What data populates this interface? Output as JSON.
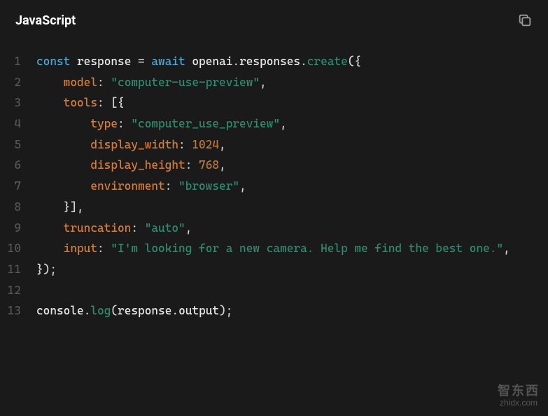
{
  "header": {
    "language_label": "JavaScript"
  },
  "code": {
    "lines": [
      {
        "num": "1",
        "tokens": [
          {
            "cls": "tk-keyword",
            "t": "const"
          },
          {
            "cls": "",
            "t": " "
          },
          {
            "cls": "tk-variable",
            "t": "response"
          },
          {
            "cls": "",
            "t": " "
          },
          {
            "cls": "tk-operator",
            "t": "="
          },
          {
            "cls": "",
            "t": " "
          },
          {
            "cls": "tk-keyword",
            "t": "await"
          },
          {
            "cls": "",
            "t": " "
          },
          {
            "cls": "tk-object",
            "t": "openai"
          },
          {
            "cls": "tk-punct",
            "t": "."
          },
          {
            "cls": "tk-object",
            "t": "responses"
          },
          {
            "cls": "tk-punct",
            "t": "."
          },
          {
            "cls": "tk-method",
            "t": "create"
          },
          {
            "cls": "tk-punct",
            "t": "({"
          }
        ]
      },
      {
        "num": "2",
        "tokens": [
          {
            "cls": "",
            "t": "    "
          },
          {
            "cls": "tk-propkey",
            "t": "model"
          },
          {
            "cls": "tk-punct",
            "t": ": "
          },
          {
            "cls": "tk-string",
            "t": "\"computer-use-preview\""
          },
          {
            "cls": "tk-punct",
            "t": ","
          }
        ]
      },
      {
        "num": "3",
        "tokens": [
          {
            "cls": "",
            "t": "    "
          },
          {
            "cls": "tk-propkey",
            "t": "tools"
          },
          {
            "cls": "tk-punct",
            "t": ": [{"
          }
        ]
      },
      {
        "num": "4",
        "tokens": [
          {
            "cls": "",
            "t": "        "
          },
          {
            "cls": "tk-propkey",
            "t": "type"
          },
          {
            "cls": "tk-punct",
            "t": ": "
          },
          {
            "cls": "tk-string",
            "t": "\"computer_use_preview\""
          },
          {
            "cls": "tk-punct",
            "t": ","
          }
        ]
      },
      {
        "num": "5",
        "tokens": [
          {
            "cls": "",
            "t": "        "
          },
          {
            "cls": "tk-propkey",
            "t": "display_width"
          },
          {
            "cls": "tk-punct",
            "t": ": "
          },
          {
            "cls": "tk-number",
            "t": "1024"
          },
          {
            "cls": "tk-punct",
            "t": ","
          }
        ]
      },
      {
        "num": "6",
        "tokens": [
          {
            "cls": "",
            "t": "        "
          },
          {
            "cls": "tk-propkey",
            "t": "display_height"
          },
          {
            "cls": "tk-punct",
            "t": ": "
          },
          {
            "cls": "tk-number",
            "t": "768"
          },
          {
            "cls": "tk-punct",
            "t": ","
          }
        ]
      },
      {
        "num": "7",
        "tokens": [
          {
            "cls": "",
            "t": "        "
          },
          {
            "cls": "tk-propkey",
            "t": "environment"
          },
          {
            "cls": "tk-punct",
            "t": ": "
          },
          {
            "cls": "tk-string",
            "t": "\"browser\""
          },
          {
            "cls": "tk-punct",
            "t": ","
          }
        ]
      },
      {
        "num": "8",
        "tokens": [
          {
            "cls": "",
            "t": "    "
          },
          {
            "cls": "tk-punct",
            "t": "}],"
          }
        ]
      },
      {
        "num": "9",
        "tokens": [
          {
            "cls": "",
            "t": "    "
          },
          {
            "cls": "tk-propkey",
            "t": "truncation"
          },
          {
            "cls": "tk-punct",
            "t": ": "
          },
          {
            "cls": "tk-string",
            "t": "\"auto\""
          },
          {
            "cls": "tk-punct",
            "t": ","
          }
        ]
      },
      {
        "num": "10",
        "tokens": [
          {
            "cls": "",
            "t": "    "
          },
          {
            "cls": "tk-propkey",
            "t": "input"
          },
          {
            "cls": "tk-punct",
            "t": ": "
          },
          {
            "cls": "tk-string",
            "t": "\"I'm looking for a new camera. Help me find the best one.\""
          },
          {
            "cls": "tk-punct",
            "t": ","
          }
        ]
      },
      {
        "num": "11",
        "tokens": [
          {
            "cls": "tk-punct",
            "t": "});"
          }
        ]
      },
      {
        "num": "12",
        "tokens": [
          {
            "cls": "",
            "t": ""
          }
        ]
      },
      {
        "num": "13",
        "tokens": [
          {
            "cls": "tk-object",
            "t": "console"
          },
          {
            "cls": "tk-punct",
            "t": "."
          },
          {
            "cls": "tk-method",
            "t": "log"
          },
          {
            "cls": "tk-punct",
            "t": "("
          },
          {
            "cls": "tk-object",
            "t": "response"
          },
          {
            "cls": "tk-punct",
            "t": "."
          },
          {
            "cls": "tk-object",
            "t": "output"
          },
          {
            "cls": "tk-punct",
            "t": ");"
          }
        ]
      }
    ]
  },
  "watermark": {
    "line1": "智东西",
    "line2": "zhidx.com"
  }
}
